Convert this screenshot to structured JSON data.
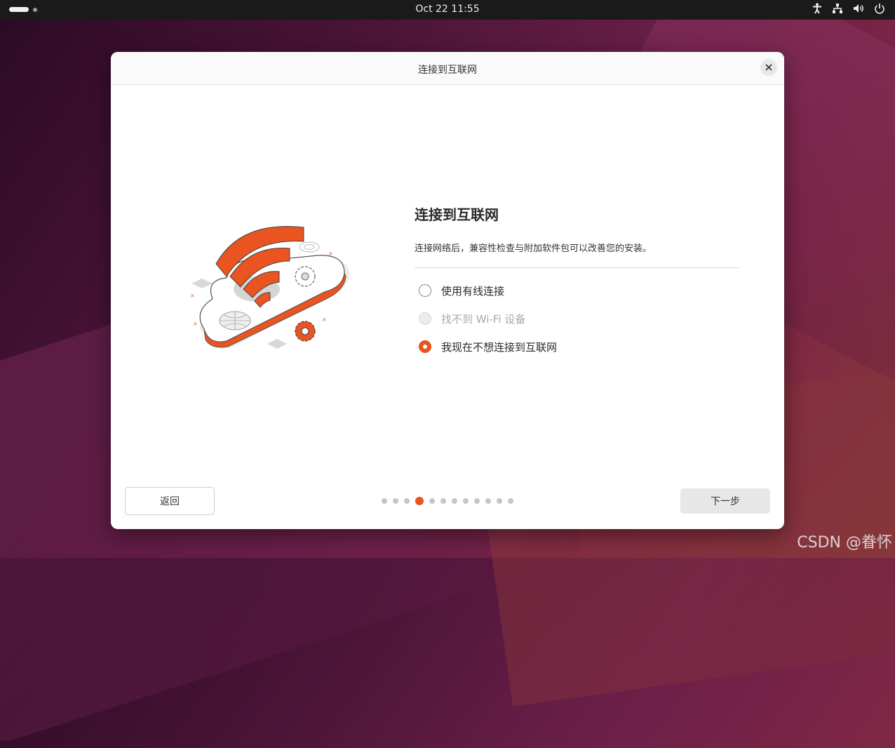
{
  "topbar": {
    "clock": "Oct 22  11:55",
    "tray_icons": [
      "accessibility-icon",
      "network-icon",
      "volume-icon",
      "power-icon"
    ]
  },
  "dialog": {
    "window_title": "连接到互联网",
    "heading": "连接到互联网",
    "description": "连接网络后，兼容性检查与附加软件包可以改善您的安装。",
    "options": [
      {
        "label": "使用有线连接",
        "state": "unselected"
      },
      {
        "label": "找不到 Wi-Fi 设备",
        "state": "disabled"
      },
      {
        "label": "我现在不想连接到互联网",
        "state": "selected"
      }
    ],
    "back_label": "返回",
    "next_label": "下一步",
    "progress": {
      "total_steps": 12,
      "current_step": 4
    }
  },
  "colors": {
    "accent": "#e95420",
    "topbar": "#1a1a1a"
  },
  "watermark": "CSDN @眷怀"
}
